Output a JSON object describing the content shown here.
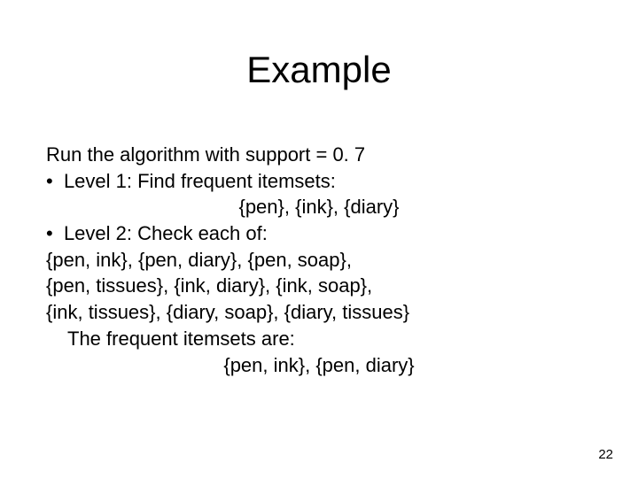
{
  "slide": {
    "title": "Example",
    "page_number": "22",
    "lines": {
      "l0": "Run the algorithm with support = 0. 7",
      "l1": "Level 1: Find frequent itemsets:",
      "l2": "{pen}, {ink}, {diary}",
      "l3": "Level 2: Check each of:",
      "l4": "{pen, ink}, {pen, diary}, {pen, soap},",
      "l5": "{pen, tissues}, {ink, diary}, {ink, soap},",
      "l6": "{ink, tissues}, {diary, soap}, {diary, tissues}",
      "l7": "The frequent itemsets are:",
      "l8": "{pen, ink}, {pen, diary}"
    }
  }
}
